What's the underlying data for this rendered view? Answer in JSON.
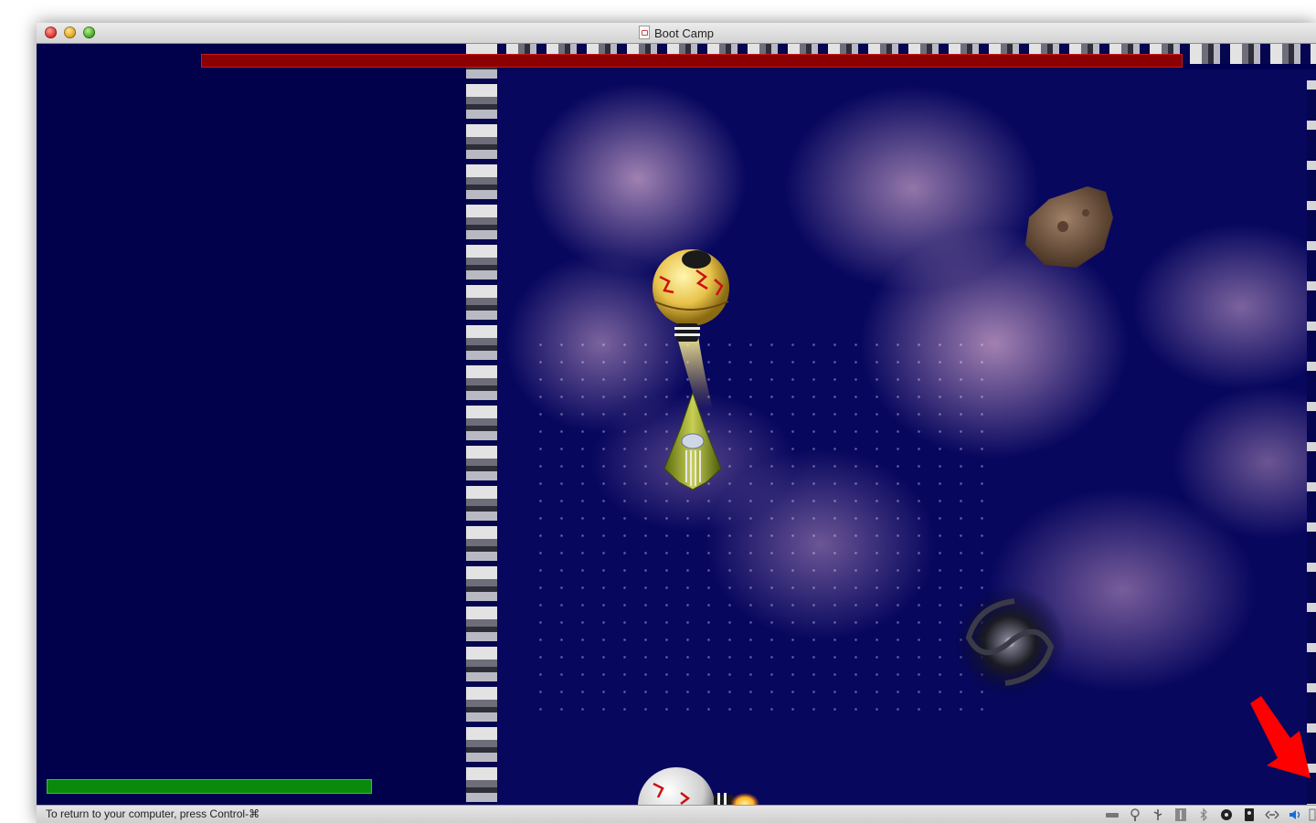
{
  "window": {
    "title": "Boot Camp"
  },
  "game": {
    "player_health_level": 1.0,
    "enemy_health_level": 1.0,
    "sprites": [
      "yellow-bomb-ship",
      "green-fighter-ship",
      "asteroid",
      "black-hole",
      "white-bomb-ship"
    ]
  },
  "statusbar": {
    "message": "To return to your computer, press Control-⌘",
    "icons": [
      "harddisk-icon",
      "network-icon",
      "usb-icon",
      "usb-device-icon",
      "bluetooth-icon",
      "cd-icon",
      "storage-icon",
      "shared-folder-icon",
      "audio-icon",
      "more-icon"
    ]
  },
  "annotation": {
    "arrow_color": "#ff0000"
  },
  "colors": {
    "game_background": "#000050",
    "enemy_health_bar": "#8b0000",
    "player_health_bar": "#0a8a0a"
  }
}
